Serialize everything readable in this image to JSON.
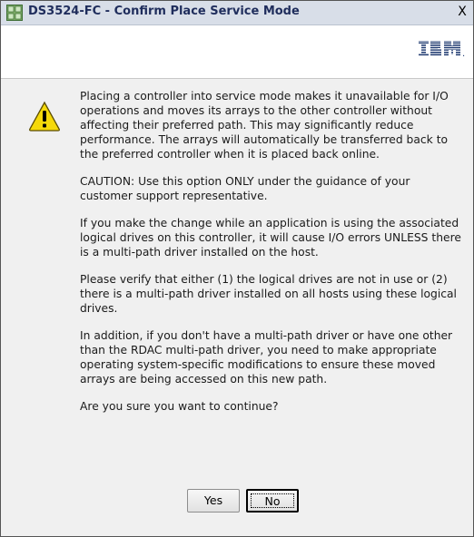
{
  "window": {
    "title": "DS3524-FC - Confirm Place Service Mode",
    "close_label": "X",
    "app_icon": "storage-manager-icon"
  },
  "header": {
    "logo_text": "IBM",
    "logo_suffix": "."
  },
  "icon": "warning-icon",
  "message": {
    "p1": "Placing a controller into service mode makes it unavailable for I/O operations and moves its arrays to the other controller without affecting their preferred path. This may significantly reduce performance. The arrays will automatically be transferred back to the preferred controller when it is placed back online.",
    "p2": "CAUTION: Use this option ONLY under the guidance of your customer support representative.",
    "p3": "If you make the change while an application is using the associated logical drives on this controller, it will cause I/O errors UNLESS there is a multi-path driver installed on the host.",
    "p4": "Please verify that either (1) the logical drives are not in use or (2) there is a multi-path driver installed on all hosts using these logical drives.",
    "p5": "In addition, if you don't have a multi-path driver or have one other than the RDAC multi-path driver, you need to make appropriate operating system-specific modifications to ensure these moved arrays are being accessed on this new path.",
    "p6": "Are you sure you want to continue?"
  },
  "buttons": {
    "yes": "Yes",
    "no": "No"
  },
  "colors": {
    "title_text": "#1f2d5c",
    "warning_fill": "#f5d90a",
    "logo_blue": "#1f3a70"
  }
}
